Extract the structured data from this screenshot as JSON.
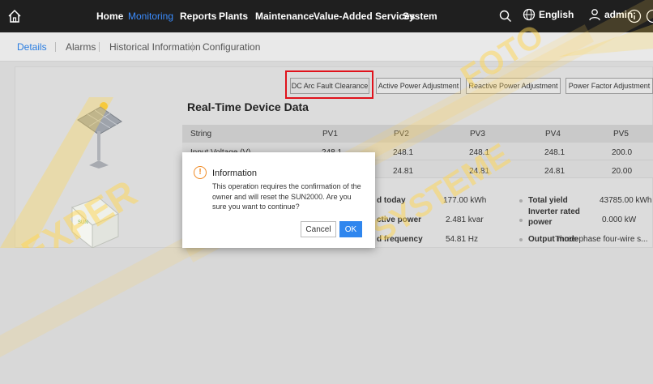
{
  "nav": {
    "items": [
      "Home",
      "Monitoring",
      "Reports",
      "Plants",
      "Maintenance",
      "Value-Added Services",
      "System"
    ],
    "active": "Monitoring",
    "language": "English",
    "user": "admin"
  },
  "subtabs": [
    "Details",
    "Alarms",
    "Historical Information",
    "Configuration"
  ],
  "actions": [
    "DC Arc Fault Clearance",
    "Active Power Adjustment",
    "Reactive Power Adjustment",
    "Power Factor Adjustment"
  ],
  "section_title": "Real-Time Device Data",
  "table": {
    "headers": [
      "String",
      "PV1",
      "PV2",
      "PV3",
      "PV4",
      "PV5"
    ],
    "rows": [
      [
        "Input Voltage (V)",
        "248.1",
        "248.1",
        "248.1",
        "248.1",
        "200.0"
      ],
      [
        "",
        "24.81",
        "24.81",
        "24.81",
        "24.81",
        "20.00"
      ]
    ]
  },
  "stats": [
    {
      "label": "d today",
      "value": "177.00 kWh",
      "label2": "Total yield",
      "value2": "43785.00 kWh"
    },
    {
      "label": "ctive power",
      "value": "2.481 kvar",
      "label2": "Inverter rated power",
      "value2": "0.000 kW"
    },
    {
      "label": "d frequency",
      "value": "54.81 Hz",
      "label2": "Output mode",
      "value2": "Three-phase four-wire s..."
    }
  ],
  "modal": {
    "title": "Information",
    "message": "This operation requires the confirmation of the owner and will reset the SUN2000. Are you sure you want to continue?",
    "cancel": "Cancel",
    "ok": "OK"
  },
  "colors": {
    "accent": "#2f86ee",
    "highlight": "#e0121b",
    "warning": "#f08a24"
  }
}
